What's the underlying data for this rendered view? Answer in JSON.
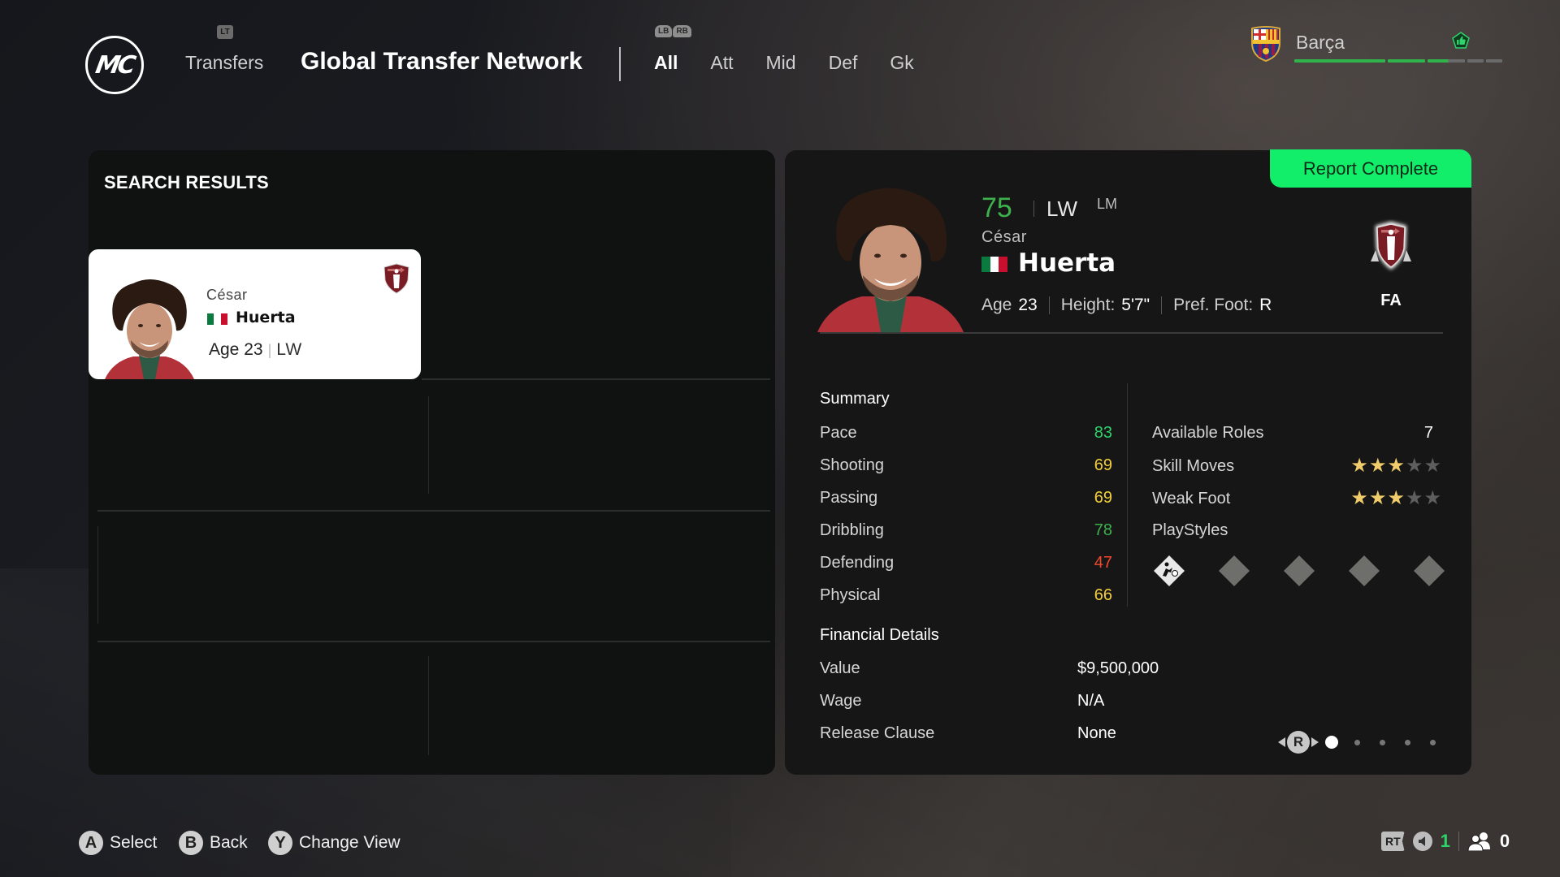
{
  "header": {
    "logo_text": "MC",
    "lt_hint": "LT",
    "nav_back_label": "Transfers",
    "title": "Global Transfer Network",
    "bumper_hints": [
      "LB",
      "RB"
    ],
    "tabs": [
      {
        "label": "All",
        "active": true
      },
      {
        "label": "Att",
        "active": false
      },
      {
        "label": "Mid",
        "active": false
      },
      {
        "label": "Def",
        "active": false
      },
      {
        "label": "Gk",
        "active": false
      }
    ]
  },
  "club": {
    "name": "Barça",
    "crest_text": "FCB",
    "progress_segments": [
      1.0,
      1.0,
      0.55,
      0,
      0
    ],
    "progress_color": "#2fb34a",
    "mood_icon": "thumbs-up-icon"
  },
  "search_results": {
    "title": "SEARCH RESULTS",
    "cards": [
      {
        "first_name": "César",
        "last_name": "Huerta",
        "nation": "Mexico",
        "age_label": "Age",
        "age": "23",
        "position": "LW",
        "status_icon": "free-agent-badge-icon"
      }
    ]
  },
  "player_detail": {
    "report_status": "Report Complete",
    "report_color": "#12ee6a",
    "overall": "75",
    "overall_color": "#3db24c",
    "primary_position": "LW",
    "alt_position": "LM",
    "first_name": "César",
    "last_name": "Huerta",
    "nation": "Mexico",
    "age_label": "Age",
    "age": "23",
    "height_label": "Height:",
    "height": "5'7\"",
    "foot_label": "Pref. Foot:",
    "foot": "R",
    "contract_status": "FA",
    "summary_title": "Summary",
    "summary": [
      {
        "label": "Pace",
        "value": "83",
        "color": "#2fd36a"
      },
      {
        "label": "Shooting",
        "value": "69",
        "color": "#f3cf3c"
      },
      {
        "label": "Passing",
        "value": "69",
        "color": "#f3cf3c"
      },
      {
        "label": "Dribbling",
        "value": "78",
        "color": "#3db24c"
      },
      {
        "label": "Defending",
        "value": "47",
        "color": "#f0482d"
      },
      {
        "label": "Physical",
        "value": "66",
        "color": "#f3cf3c"
      }
    ],
    "attributes": {
      "available_roles_label": "Available Roles",
      "available_roles": "7",
      "skill_moves_label": "Skill Moves",
      "skill_moves": 3,
      "weak_foot_label": "Weak Foot",
      "weak_foot": 3,
      "stars_max": 5,
      "star_on_color": "#f0cd6a",
      "star_off_color": "#5e5e5e",
      "playstyles_label": "PlayStyles",
      "playstyles": [
        {
          "name": "playstyle-finesse-shot-icon",
          "filled": true
        },
        {
          "name": "playstyle-empty-slot-icon",
          "filled": false
        },
        {
          "name": "playstyle-empty-slot-icon",
          "filled": false
        },
        {
          "name": "playstyle-empty-slot-icon",
          "filled": false
        },
        {
          "name": "playstyle-empty-slot-icon",
          "filled": false
        }
      ]
    },
    "financial_title": "Financial Details",
    "financial": [
      {
        "label": "Value",
        "value": "$9,500,000"
      },
      {
        "label": "Wage",
        "value": "N/A"
      },
      {
        "label": "Release Clause",
        "value": "None"
      }
    ],
    "pager": {
      "button": "R",
      "pages": 5,
      "current": 1
    }
  },
  "footer": {
    "hints": [
      {
        "button": "A",
        "label": "Select"
      },
      {
        "button": "B",
        "label": "Back"
      },
      {
        "button": "Y",
        "label": "Change View"
      }
    ],
    "tray": {
      "rt_label": "RT",
      "voice_count": "1",
      "voice_color": "#2fd36a",
      "party_count": "0"
    }
  }
}
